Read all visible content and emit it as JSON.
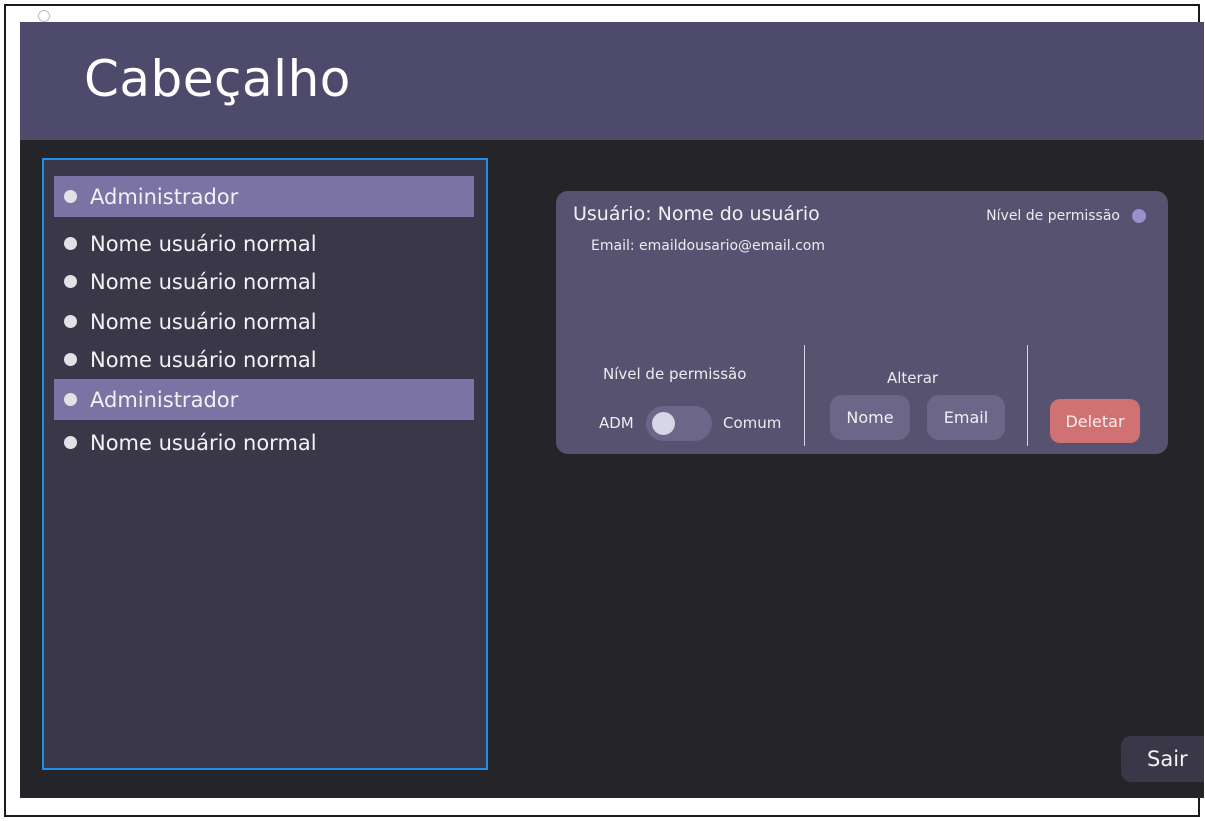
{
  "header": {
    "title": "Cabeçalho"
  },
  "sidebar": {
    "items": [
      {
        "label": "Administrador",
        "selected": true
      },
      {
        "label": "Nome usuário normal",
        "selected": false
      },
      {
        "label": "Nome usuário normal",
        "selected": false
      },
      {
        "label": "Nome usuário normal",
        "selected": false
      },
      {
        "label": "Nome usuário normal",
        "selected": false
      },
      {
        "label": "Administrador",
        "selected": true
      },
      {
        "label": "Nome usuário normal",
        "selected": false
      }
    ]
  },
  "card": {
    "title": "Usuário: Nome do usuário",
    "email": "Email: emaildousario@email.com",
    "permission_indicator_label": "Nível de permissão",
    "permission_section_label": "Nível de permissão",
    "toggle_left_label": "ADM",
    "toggle_right_label": "Comum",
    "change_section_label": "Alterar",
    "name_button": "Nome",
    "email_button": "Email",
    "delete_button": "Deletar"
  },
  "exit_button": "Sair",
  "colors": {
    "header_bg": "#4e4a6c",
    "app_bg": "#252429",
    "sidebar_bg": "#393748",
    "sidebar_border": "#1e90e8",
    "selected_item": "#7a73a4",
    "card_bg": "#565270",
    "button_bg": "#6c6689",
    "delete_bg": "#d07274"
  }
}
